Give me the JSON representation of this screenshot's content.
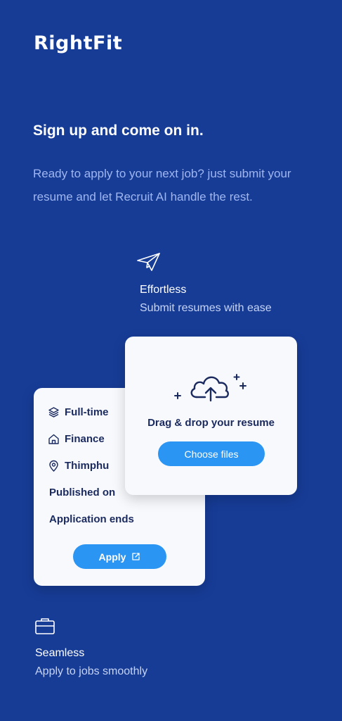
{
  "brand": {
    "logo": "RightFit"
  },
  "hero": {
    "headline": "Sign up and come on in.",
    "lead": "Ready to apply to your next job? just submit your resume and let Recruit AI handle the rest."
  },
  "features": [
    {
      "icon": "paper-plane-icon",
      "title": "Effortless",
      "desc": "Submit resumes with ease"
    },
    {
      "icon": "briefcase-icon",
      "title": "Seamless",
      "desc": "Apply to jobs smoothly"
    }
  ],
  "job_card": {
    "rows": [
      {
        "icon": "layers-icon",
        "label": "Full-time"
      },
      {
        "icon": "home-icon",
        "label": "Finance"
      },
      {
        "icon": "location-pin-icon",
        "label": "Thimphu"
      },
      {
        "label": "Published on"
      },
      {
        "label": "Application ends"
      }
    ],
    "apply_label": "Apply",
    "apply_icon": "external-link-icon"
  },
  "upload_card": {
    "icon": "cloud-upload-icon",
    "drop_text": "Drag & drop your resume",
    "button_label": "Choose files"
  },
  "colors": {
    "background": "#173c96",
    "accent": "#2b95f3",
    "card": "#f7f9fd",
    "card_text": "#1b2a5e",
    "lead_text": "#9fb6f0"
  }
}
